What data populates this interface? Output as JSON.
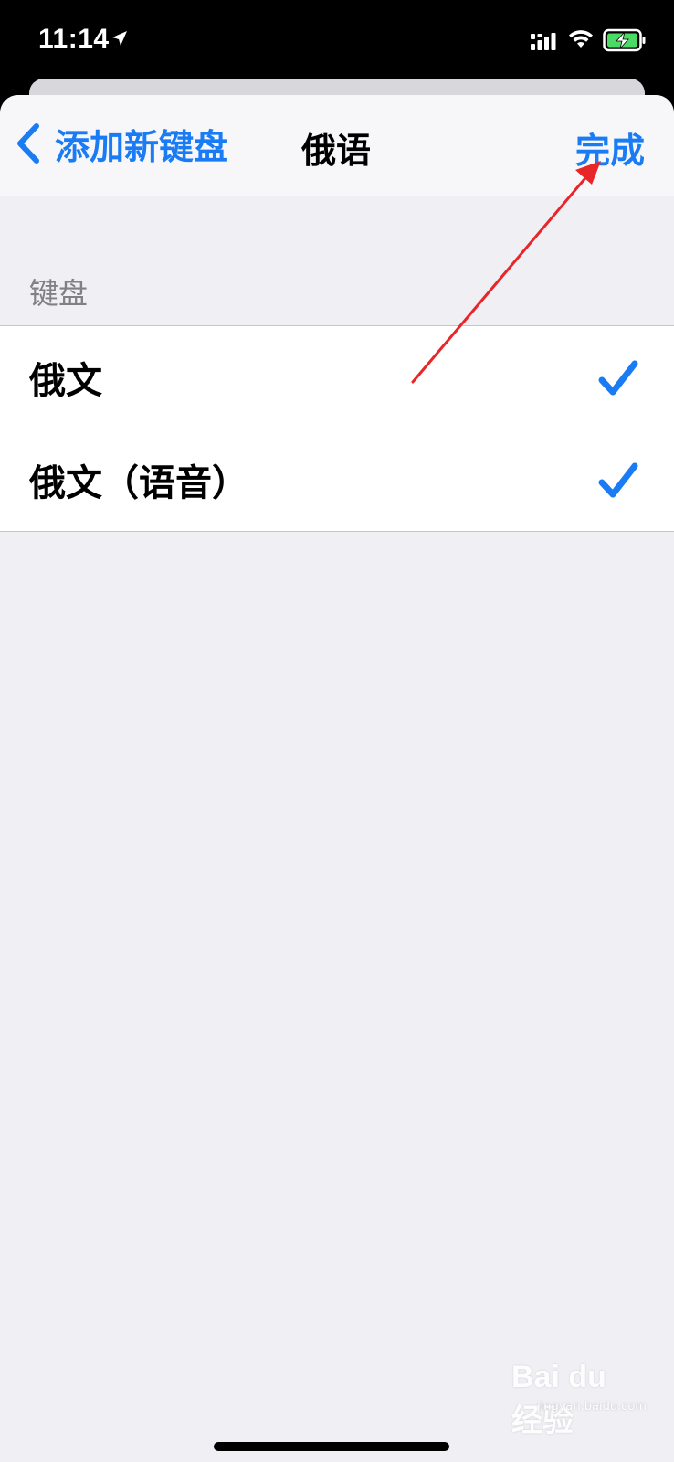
{
  "status_bar": {
    "time": "11:14"
  },
  "nav": {
    "back_label": "添加新键盘",
    "title": "俄语",
    "done_label": "完成"
  },
  "section": {
    "header": "键盘"
  },
  "keyboards": [
    {
      "label": "俄文",
      "checked": true
    },
    {
      "label": "俄文（语音）",
      "checked": true
    }
  ],
  "watermark": {
    "logo": "Bai du 经验",
    "sub": "jingyan.baidu.com"
  },
  "colors": {
    "accent": "#1a7cf5",
    "background": "#f0eff4",
    "annotation": "#e8262a"
  }
}
